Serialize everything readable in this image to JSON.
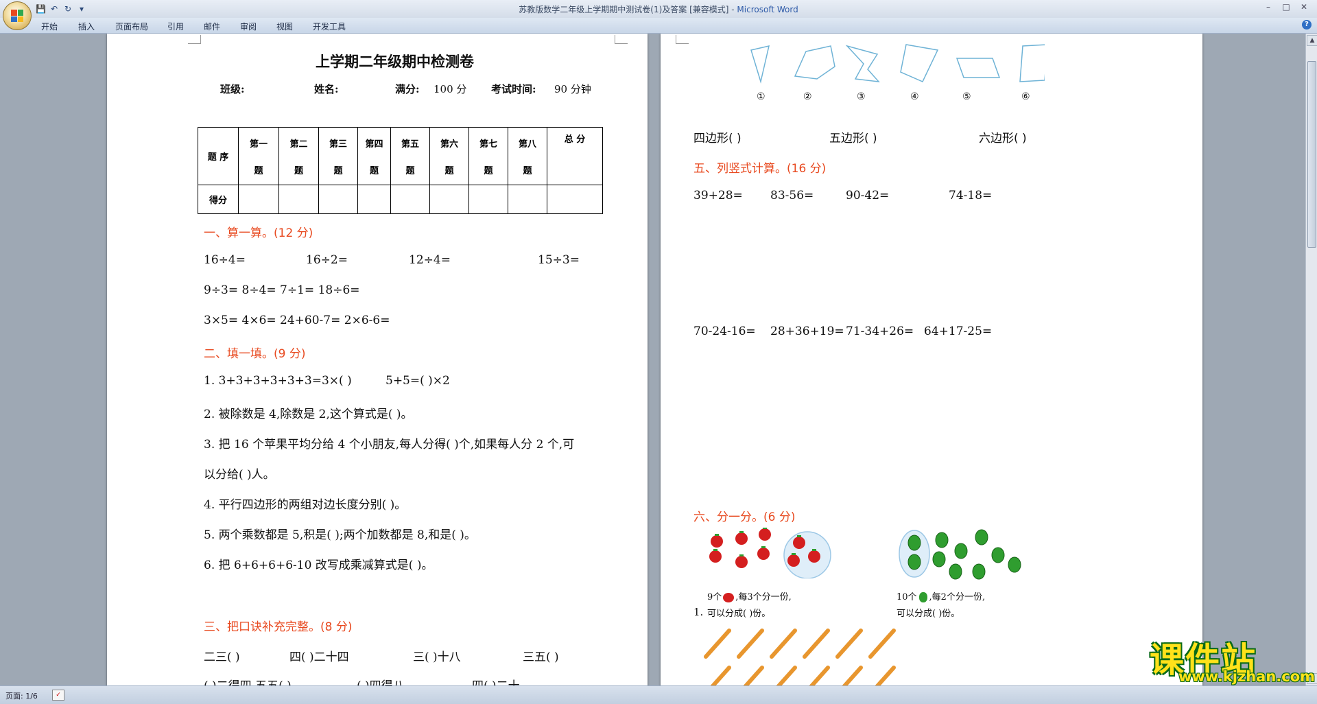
{
  "window": {
    "title": "苏教版数学二年级上学期期中测试卷(1)及答案 [兼容模式] - ",
    "app_name": "Microsoft Word"
  },
  "quick_access": [
    "save-icon",
    "undo-icon",
    "redo-icon",
    "customize-icon"
  ],
  "ribbon_tabs": [
    "开始",
    "插入",
    "页面布局",
    "引用",
    "邮件",
    "审阅",
    "视图",
    "开发工具"
  ],
  "status": {
    "page_indicator": "页面: 1/6"
  },
  "page1": {
    "title": "上学期二年级期中检测卷",
    "header_line": {
      "class_label": "班级:",
      "name_label": "姓名:",
      "score_label": "满分:",
      "score_value": "100 分",
      "time_label": "考试时间:",
      "time_value": "90 分钟"
    },
    "table": {
      "row1_label": "题 序",
      "columns": [
        {
          "a": "第一",
          "b": "题"
        },
        {
          "a": "第二",
          "b": "题"
        },
        {
          "a": "第三",
          "b": "题"
        },
        {
          "a": "第四",
          "b": "题"
        },
        {
          "a": "第五",
          "b": "题"
        },
        {
          "a": "第六",
          "b": "题"
        },
        {
          "a": "第七",
          "b": "题"
        },
        {
          "a": "第八",
          "b": "题"
        }
      ],
      "total_label": "总    分",
      "row2_label": "得分"
    },
    "sec1": {
      "title": "一、算一算。(12 分)",
      "row1": [
        "16÷4=",
        "16÷2=",
        "12÷4=",
        "15÷3="
      ],
      "row2": "9÷3= 8÷4= 7÷1= 18÷6=",
      "row3": "3×5= 4×6= 24+60-7= 2×6-6="
    },
    "sec2": {
      "title": "二、填一填。(9 分)",
      "q1a": "1. 3+3+3+3+3+3=3×(      )",
      "q1b": "5+5=(      )×2",
      "q2": "2. 被除数是 4,除数是 2,这个算式是(              )。",
      "q3a": "3. 把 16 个苹果平均分给 4 个小朋友,每人分得(       )个,如果每人分 2 个,可",
      "q3b": "以分给(       )人。",
      "q4": "4. 平行四边形的两组对边长度分别(       )。",
      "q5": "5. 两个乘数都是 5,积是(      );两个加数都是 8,和是(       )。",
      "q6": "6. 把 6+6+6+6-10 改写成乘减算式是(              )。"
    },
    "sec3": {
      "title": "三、把口诀补充完整。(8 分)",
      "row1": [
        "二三(       )",
        "四(       )二十四",
        "三(       )十八",
        "三五(       )"
      ],
      "row2": [
        "(       )二得四 五五(       )",
        "(       )四得八",
        "四(       )二十"
      ]
    }
  },
  "page2": {
    "shape_labels": [
      "①",
      "②",
      "③",
      "④",
      "⑤",
      "⑥"
    ],
    "poly_line": [
      "四边形(              )",
      "五边形(              )",
      "六边形(              )"
    ],
    "sec5": {
      "title": "五、列竖式计算。(16 分)",
      "row1": [
        "39+28=",
        "83-56=",
        "90-42=",
        "74-18="
      ],
      "row2": [
        "70-24-16=",
        "28+36+19=",
        "71-34+26=",
        "64+17-25="
      ]
    },
    "sec6": {
      "title": "六、分一分。(6 分)",
      "item_number": "1.",
      "left_caption_1a": "9个",
      "left_caption_1b": ",每3个分一份,",
      "left_caption_2": "可以分成(      )份。",
      "right_caption_1a": "10个",
      "right_caption_1b": ",每2个分一份,",
      "right_caption_2": "可以分成(      )份。"
    }
  },
  "watermark": {
    "main": "课件站",
    "url": "www.kjzhan.com"
  },
  "colors": {
    "section_red": "#e8491f",
    "tomato_red": "#d41f1f",
    "pepper_green": "#2f9d2f",
    "pencil_orange": "#e8962e"
  }
}
